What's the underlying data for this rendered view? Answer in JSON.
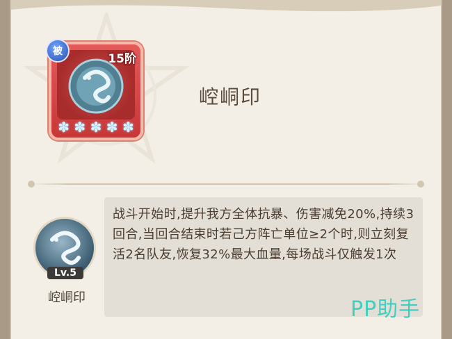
{
  "skill": {
    "name": "崆峒印",
    "tier_label": "15阶",
    "passive_tag": "被",
    "stars": 5,
    "level_label": "Lv.5",
    "description": "战斗开始时,提升我方全体抗暴、伤害减免20%,持续3回合,当回合结束时若己方阵亡单位≥2个时,则立刻复活2名队友,恢复32%最大血量,每场战斗仅触发1次"
  },
  "icons": {
    "passive": "passive-badge-icon",
    "card_art": "dragon-seal-icon",
    "star": "snowflake-star-icon",
    "small_art": "dragon-seal-icon"
  },
  "colors": {
    "card_red": "#c93636",
    "card_border": "#f6b8a8",
    "passive_blue": "#2b4fb0",
    "panel_bg": "#f3efe6",
    "desc_bg": "#e4dfd6",
    "watermark": "#3ecfc0"
  },
  "watermark": "PP助手"
}
